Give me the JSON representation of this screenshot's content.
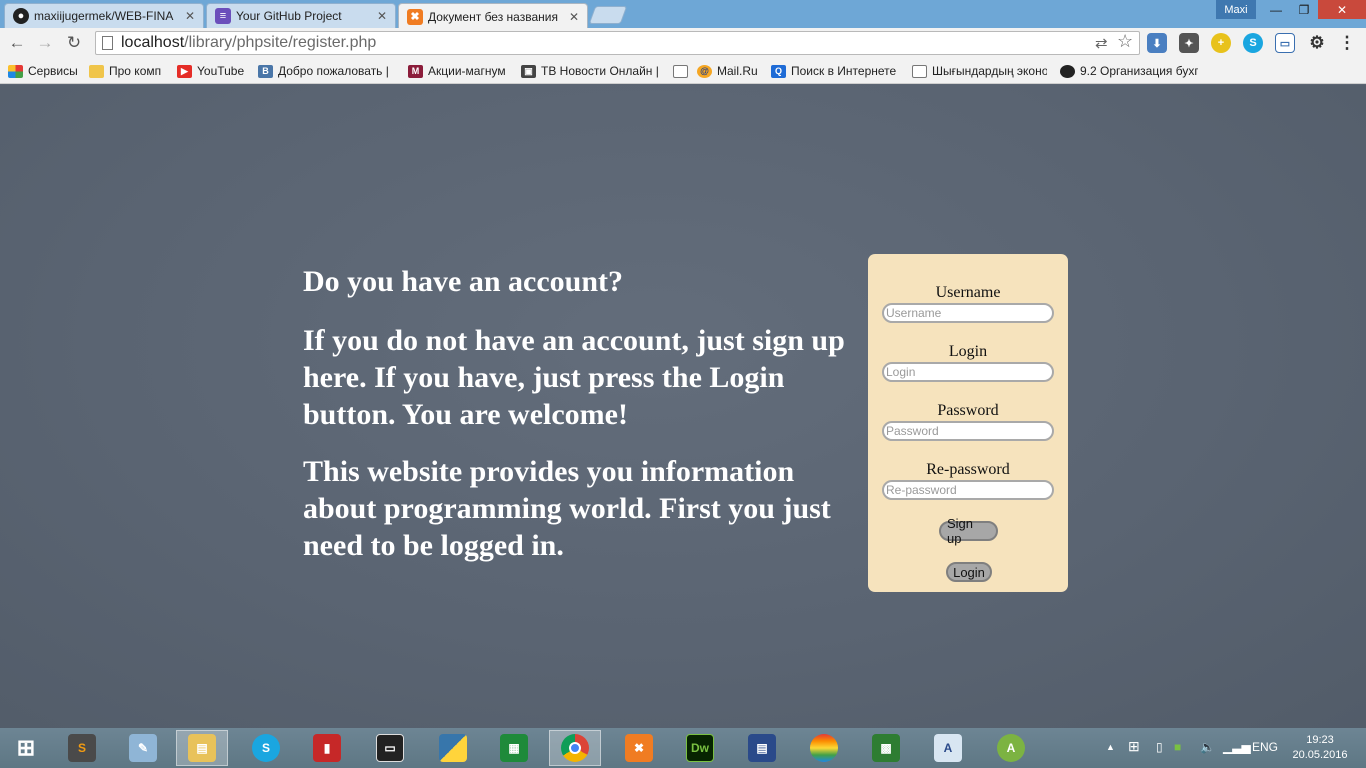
{
  "browser": {
    "tabs": [
      {
        "label": "maxiijugermek/WEB-FINA",
        "icon": "github-icon",
        "active": false
      },
      {
        "label": "Your GitHub Project",
        "icon": "project-icon",
        "active": false
      },
      {
        "label": "Документ без названия",
        "icon": "xampp-icon",
        "active": true
      }
    ],
    "user_name": "Maxi",
    "address": {
      "host": "localhost",
      "path": "/library/phpsite/register.php"
    },
    "bookmarks": [
      {
        "label": "Сервисы",
        "icon": "apps-grid-icon"
      },
      {
        "label": "Про комп",
        "icon": "folder-icon"
      },
      {
        "label": "YouTube",
        "icon": "youtube-icon"
      },
      {
        "label": "Добро пожаловать |",
        "icon": "vk-icon"
      },
      {
        "label": "Акции-магнум",
        "icon": "magnum-icon"
      },
      {
        "label": "ТВ Новости Онлайн |",
        "icon": "tv-icon"
      },
      {
        "label": "",
        "icon": "page-icon"
      },
      {
        "label": "Mail.Ru",
        "icon": "mailru-icon"
      },
      {
        "label": "Поиск в Интернете",
        "icon": "search-icon"
      },
      {
        "label": "Шығындардың эконо",
        "icon": "page-icon"
      },
      {
        "label": "9.2 Организация бухг",
        "icon": "globe-icon"
      }
    ]
  },
  "intro": {
    "heading": "Do you have an account?",
    "paragraph1": "If you do not have an account, just sign up here. If you have, just press the Login button. You are welcome!",
    "paragraph2": "This website provides you information about programming world. First you just need to be logged in."
  },
  "form": {
    "username": {
      "label": "Username",
      "placeholder": "Username"
    },
    "login": {
      "label": "Login",
      "placeholder": "Login"
    },
    "password": {
      "label": "Password",
      "placeholder": "Password"
    },
    "repassword": {
      "label": "Re-password",
      "placeholder": "Re-password"
    },
    "signup_button": "Sign up",
    "login_button": "Login"
  },
  "taskbar": {
    "language": "ENG",
    "time": "19:23",
    "date": "20.05.2016"
  },
  "colors": {
    "page_background": "#5b6573",
    "form_background": "#f6e3bd",
    "button_background": "#a7a7a7"
  }
}
